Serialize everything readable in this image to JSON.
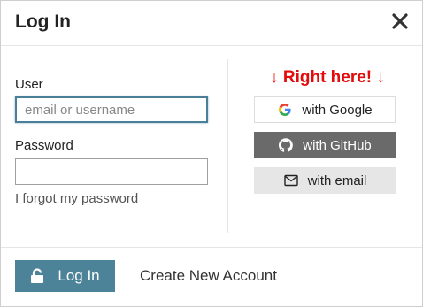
{
  "dialog": {
    "title": "Log In",
    "close_icon": "close-icon"
  },
  "form": {
    "user_label": "User",
    "user_placeholder": "email or username",
    "user_value": "",
    "password_label": "Password",
    "password_value": "",
    "forgot_link": "I forgot my password"
  },
  "social": {
    "hint": "↓ Right here! ↓",
    "hint_color": "#e20c0c",
    "buttons": [
      {
        "label": "with Google",
        "icon": "google-icon"
      },
      {
        "label": "with GitHub",
        "icon": "github-icon"
      },
      {
        "label": "with email",
        "icon": "mail-icon"
      }
    ]
  },
  "footer": {
    "login_label": "Log In",
    "login_icon": "unlock-icon",
    "create_account": "Create New Account",
    "accent_color": "#4d8399"
  }
}
